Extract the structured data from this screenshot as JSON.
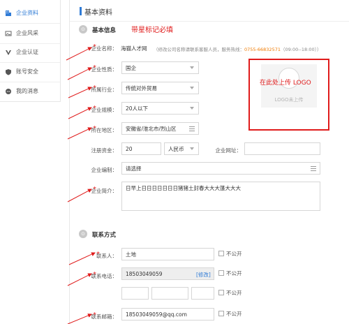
{
  "sidebar": {
    "items": [
      {
        "label": "企业资料",
        "icon": "building-icon",
        "active": true
      },
      {
        "label": "企业风采",
        "icon": "image-icon",
        "active": false
      },
      {
        "label": "企业认证",
        "icon": "v-badge-icon",
        "active": false
      },
      {
        "label": "账号安全",
        "icon": "shield-icon",
        "active": false
      },
      {
        "label": "我的消息",
        "icon": "message-icon",
        "active": false
      }
    ]
  },
  "page": {
    "title": "基本资料"
  },
  "sections": {
    "basic": "基本信息",
    "contact": "联系方式"
  },
  "annotations": {
    "required_note": "带星标记必填",
    "logo_note": "在此处上传 LOGO"
  },
  "form": {
    "company_name": {
      "label": "企业名称：",
      "value": "海猫人才网"
    },
    "company_note": {
      "prefix": "（修改公司名称请联系客服人员，服务热线：",
      "phone": "0755-66832571",
      "suffix": "（09:00--18:00））"
    },
    "nature": {
      "label": "企业性质：",
      "value": "国企"
    },
    "industry": {
      "label": "所属行业：",
      "value": "传统对外贸易"
    },
    "scale": {
      "label": "企业规模：",
      "value": "20人以下"
    },
    "region": {
      "label": "所在地区：",
      "value": "安徽省/淮北市/烈山区"
    },
    "capital": {
      "label": "注册资金：",
      "value": "20",
      "currency": "人民币"
    },
    "website": {
      "label": "企业网址：",
      "value": ""
    },
    "staffing": {
      "label": "企业编制：",
      "value": "请选择"
    },
    "intro": {
      "label": "企业简介：",
      "value": "日早上日日日日日日日猪猪土封春大大大篷大大大"
    },
    "logo_caption": "LOGO未上传"
  },
  "contact": {
    "person": {
      "label": "联系人：",
      "value": "土地",
      "private": "不公开"
    },
    "phone": {
      "label": "联系电话：",
      "value": "18503049059",
      "modify": "[修改]",
      "private": "不公开"
    },
    "landline": {
      "private": "不公开"
    },
    "email": {
      "label": "联系邮箱：",
      "value": "18503049059@qq.com",
      "private": "不公开"
    }
  },
  "colors": {
    "accent": "#2f7bd6",
    "annotation": "#e01b1b",
    "hotline": "#f07a00"
  }
}
